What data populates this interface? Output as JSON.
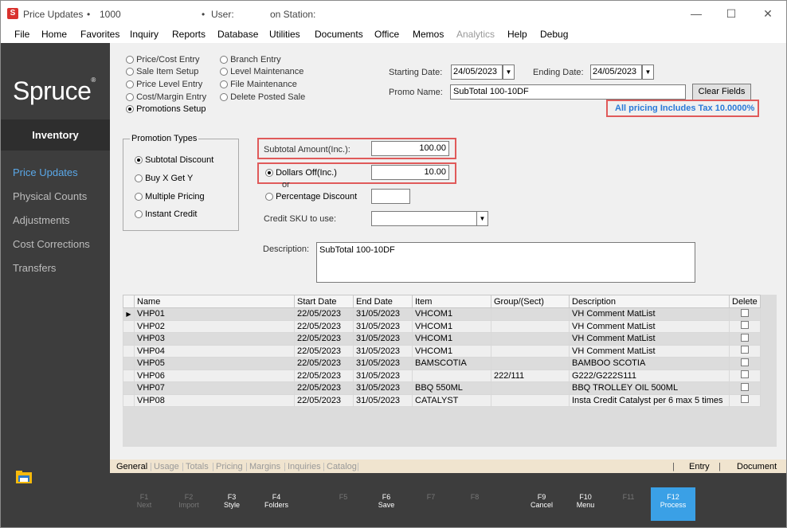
{
  "window": {
    "app_icon": "S",
    "title": "Price Updates",
    "title_sep": "•",
    "store_no": "1000",
    "user_sep": "•",
    "user_label": "User:",
    "station_label": "on Station:",
    "controls": {
      "minimize": "—",
      "maximize": "☐",
      "close": "✕"
    }
  },
  "menu": [
    "File",
    "Home",
    "Favorites",
    "Inquiry",
    "Reports",
    "Database",
    "Utilities",
    "Documents",
    "Office",
    "Memos",
    "Analytics",
    "Help",
    "Debug"
  ],
  "sidebar": {
    "brand": "Spruce",
    "brand_mark": "®",
    "section": "Inventory",
    "items": [
      "Price Updates",
      "Physical Counts",
      "Adjustments",
      "Cost Corrections",
      "Transfers"
    ],
    "active": "Price Updates"
  },
  "mode_radios": {
    "left": [
      "Price/Cost Entry",
      "Sale Item Setup",
      "Price Level Entry",
      "Cost/Margin Entry",
      "Promotions Setup"
    ],
    "right": [
      "Branch Entry",
      "Level Maintenance",
      "File Maintenance",
      "Delete Posted Sale"
    ],
    "selected": "Promotions Setup"
  },
  "header": {
    "starting_date_label": "Starting Date:",
    "starting_date": "24/05/2023",
    "ending_date_label": "Ending Date:",
    "ending_date": "24/05/2023",
    "promo_name_label": "Promo Name:",
    "promo_name": "SubTotal 100-10DF",
    "clear_button": "Clear Fields",
    "tax_note": "All pricing Includes Tax 10.0000%"
  },
  "promotion_types": {
    "legend": "Promotion Types",
    "options": [
      "Subtotal Discount",
      "Buy X Get Y",
      "Multiple Pricing",
      "Instant Credit"
    ],
    "selected": "Subtotal Discount"
  },
  "form": {
    "subtotal_label": "Subtotal Amount(Inc.):",
    "subtotal_value": "100.00",
    "dollars_off_label": "Dollars Off(Inc.)",
    "dollars_off_value": "10.00",
    "or_label": "or",
    "percentage_label": "Percentage Discount",
    "percentage_value": "",
    "credit_sku_label": "Credit SKU to use:",
    "credit_sku_value": "",
    "description_label": "Description:",
    "description_value": "SubTotal 100-10DF",
    "discount_mode": "Dollars Off(Inc.)"
  },
  "grid": {
    "columns": [
      "Name",
      "Start Date",
      "End Date",
      "Item",
      "Group/(Sect)",
      "Description",
      "Delete"
    ],
    "rows": [
      [
        "VHP01",
        "22/05/2023",
        "31/05/2023",
        "VHCOM1",
        "",
        "VH Comment MatList"
      ],
      [
        "VHP02",
        "22/05/2023",
        "31/05/2023",
        "VHCOM1",
        "",
        "VH Comment MatList"
      ],
      [
        "VHP03",
        "22/05/2023",
        "31/05/2023",
        "VHCOM1",
        "",
        "VH Comment MatList"
      ],
      [
        "VHP04",
        "22/05/2023",
        "31/05/2023",
        "VHCOM1",
        "",
        "VH Comment MatList"
      ],
      [
        "VHP05",
        "22/05/2023",
        "31/05/2023",
        "BAMSCOTIA",
        "",
        "BAMBOO SCOTIA"
      ],
      [
        "VHP06",
        "22/05/2023",
        "31/05/2023",
        "",
        "222/111",
        "G222/G222S111"
      ],
      [
        "VHP07",
        "22/05/2023",
        "31/05/2023",
        "BBQ 550ML",
        "",
        "BBQ TROLLEY OIL 500ML"
      ],
      [
        "VHP08",
        "22/05/2023",
        "31/05/2023",
        "CATALYST",
        "",
        "Insta Credit Catalyst per 6 max 5 times"
      ]
    ],
    "current_row_marker": "▶"
  },
  "tabs": {
    "items": [
      "General",
      "Usage",
      "Totals",
      "Pricing",
      "Margins",
      "Inquiries",
      "Catalog"
    ],
    "active": "General",
    "right_items": [
      "Entry",
      "Document"
    ]
  },
  "fkeys": [
    {
      "key": "F1",
      "label": "Next",
      "enabled": false
    },
    {
      "key": "F2",
      "label": "Import",
      "enabled": false
    },
    {
      "key": "F3",
      "label": "Style",
      "enabled": true
    },
    {
      "key": "F4",
      "label": "Folders",
      "enabled": true
    },
    {
      "key": "F5",
      "label": "",
      "enabled": false
    },
    {
      "key": "F6",
      "label": "Save",
      "enabled": true
    },
    {
      "key": "F7",
      "label": "",
      "enabled": false
    },
    {
      "key": "F8",
      "label": "",
      "enabled": false
    },
    {
      "key": "F9",
      "label": "Cancel",
      "enabled": true
    },
    {
      "key": "F10",
      "label": "Menu",
      "enabled": true
    },
    {
      "key": "F11",
      "label": "",
      "enabled": false
    },
    {
      "key": "F12",
      "label": "Process",
      "enabled": true
    }
  ],
  "colors": {
    "accent": "#3aa0e6",
    "sidebar_bg": "#3d3d3d",
    "highlight_box": "#e05a5a",
    "tax_note": "#2a7ad8"
  }
}
